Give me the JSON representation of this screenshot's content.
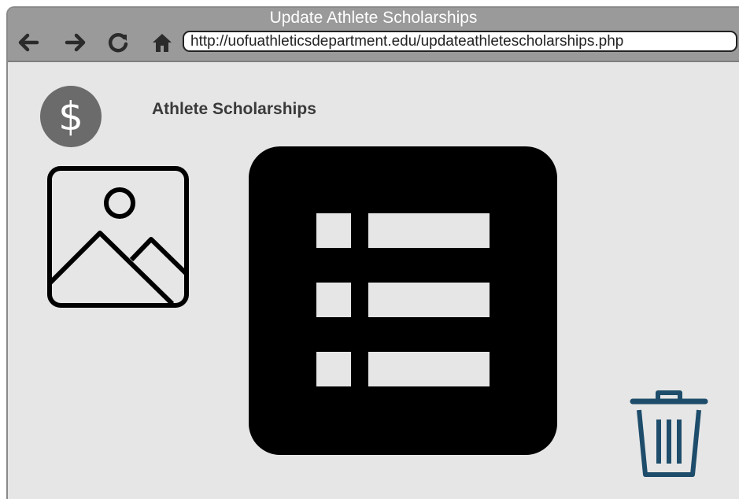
{
  "window": {
    "title": "Update Athlete Scholarships"
  },
  "toolbar": {
    "back_icon": "arrow-left-icon",
    "forward_icon": "arrow-right-icon",
    "reload_icon": "reload-icon",
    "home_icon": "home-icon",
    "url": "http://uofuathleticsdepartment.edu/updateathletescholarships.php"
  },
  "header": {
    "logo_symbol": "$",
    "heading": "Athlete Scholarships"
  },
  "icons": {
    "image_placeholder": "image-placeholder-icon",
    "list": "list-icon",
    "trash": "trash-icon"
  },
  "colors": {
    "titlebar": "#9a9a9a",
    "page_background": "#e6e6e6",
    "dollar_circle": "#6b6b6b",
    "trash_stroke": "#1e4d6b",
    "list_tile": "#000000"
  }
}
